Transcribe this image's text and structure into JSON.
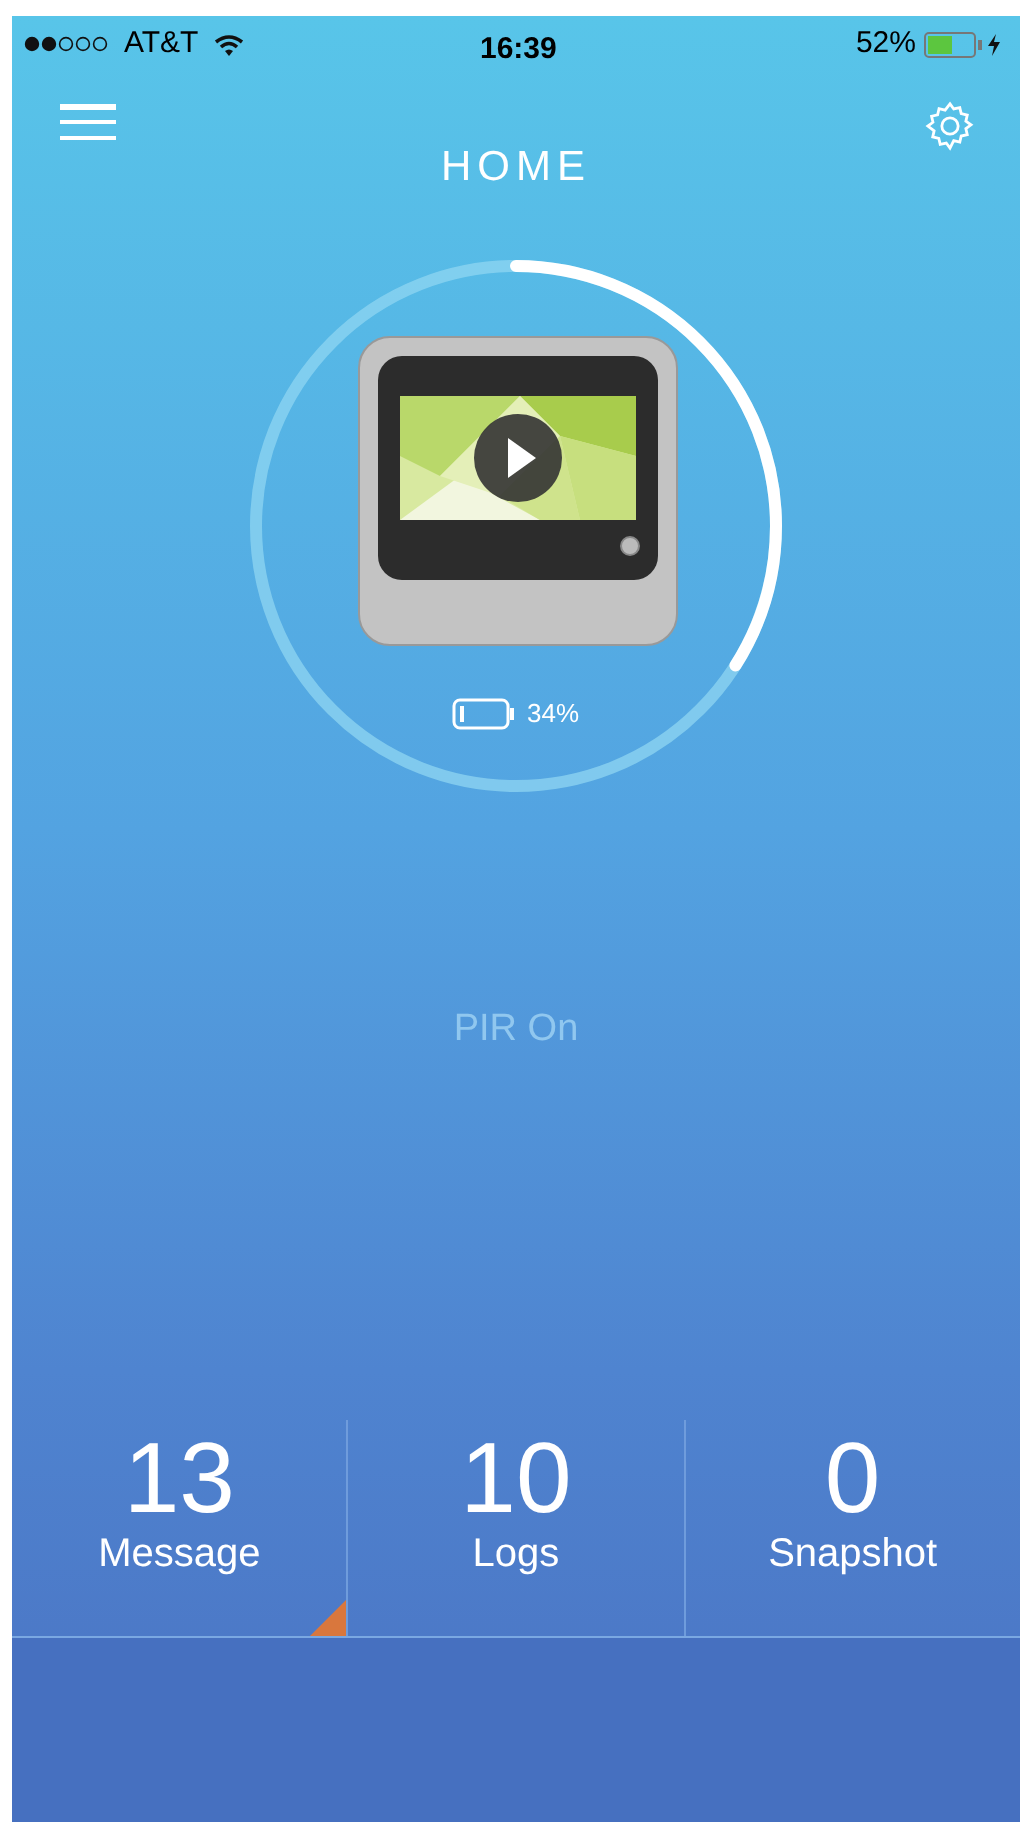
{
  "status_bar": {
    "carrier": "AT&T",
    "time": "16:39",
    "battery": "52%"
  },
  "header": {
    "title": "HOME"
  },
  "device": {
    "level": 0.34,
    "battery": "34%"
  },
  "pir_status": "PIR On",
  "stats": [
    {
      "value": "13",
      "label": "Message",
      "flagged": true
    },
    {
      "value": "10",
      "label": "Logs",
      "flagged": false
    },
    {
      "value": "0",
      "label": "Snapshot",
      "flagged": false
    }
  ]
}
